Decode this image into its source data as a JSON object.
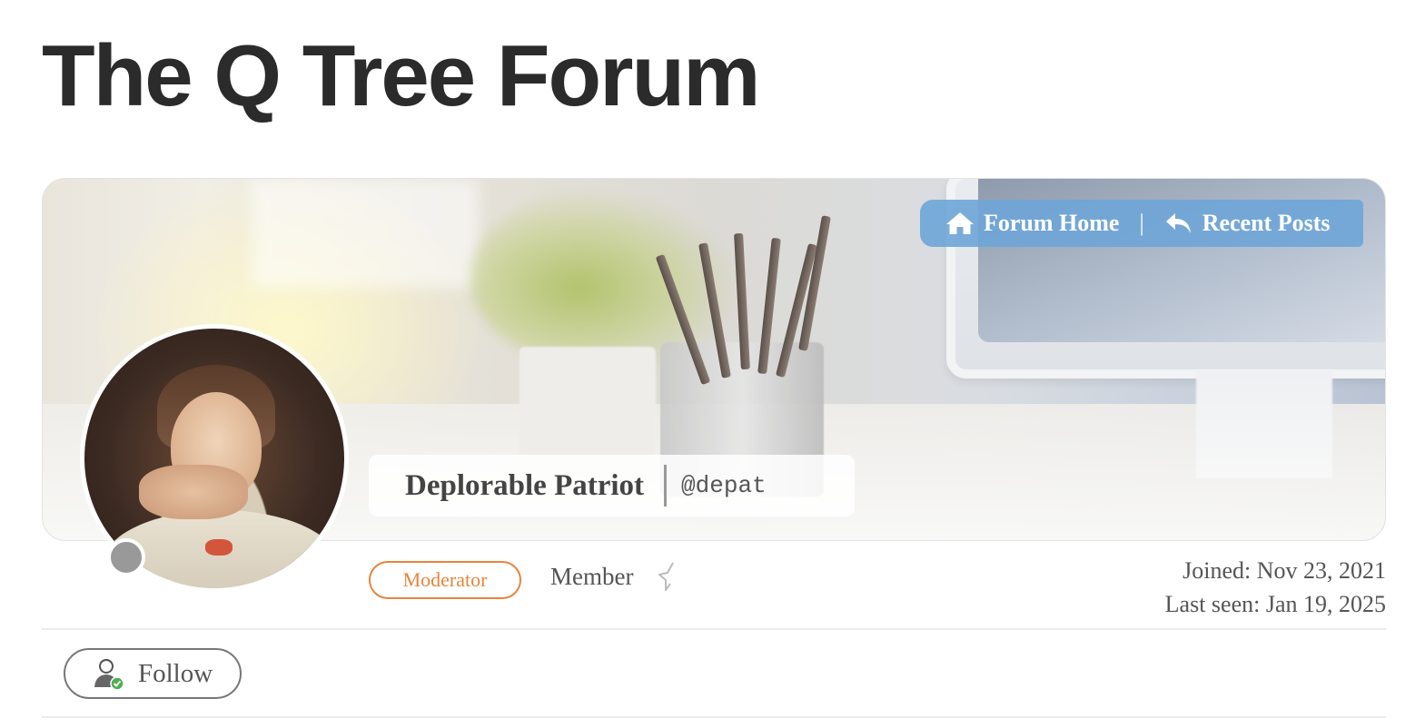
{
  "site": {
    "title": "The Q Tree Forum"
  },
  "nav": {
    "forum_home": {
      "label": "Forum Home",
      "icon": "home-icon"
    },
    "separator": "|",
    "recent_posts": {
      "label": "Recent Posts",
      "icon": "reply-icon"
    }
  },
  "profile": {
    "display_name": "Deplorable Patriot",
    "handle": "@depat",
    "online_status": "offline",
    "role_badge": "Moderator",
    "rank": "Member",
    "rank_icon": "star-outline-icon",
    "joined": "Joined: Nov 23, 2021",
    "last_seen": "Last seen: Jan 19, 2025"
  },
  "actions": {
    "follow_label": "Follow",
    "follow_icon": "user-check-icon"
  },
  "colors": {
    "nav_bg": "#6ea5d7",
    "moderator_accent": "#e8843c",
    "status_offline": "#999999"
  }
}
